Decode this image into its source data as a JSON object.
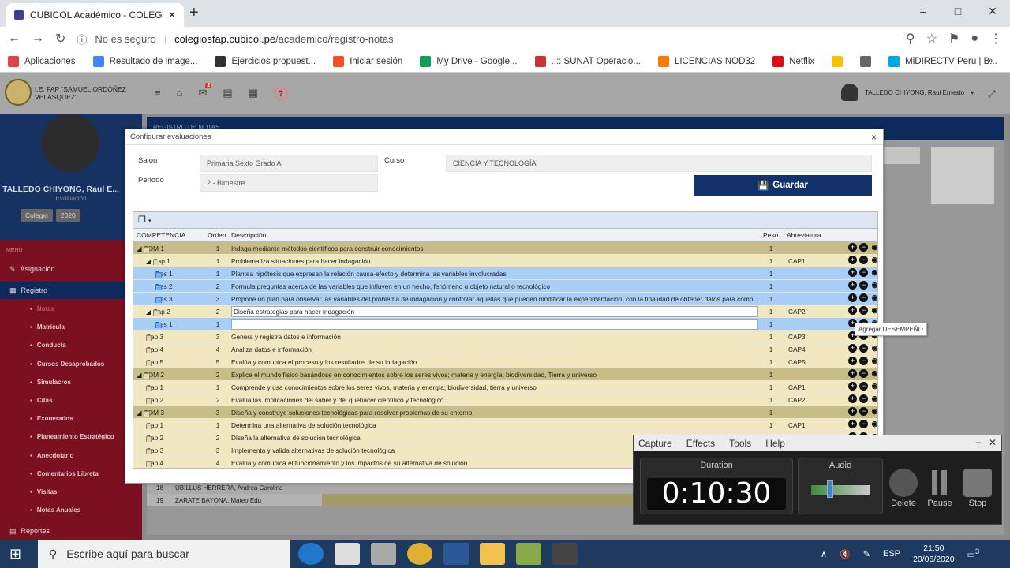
{
  "browser": {
    "tab_title": "CUBICOL Académico - COLEGIOS",
    "new_tab": "+",
    "window": {
      "minimize": "–",
      "maximize": "□",
      "close": "✕"
    },
    "security": "No es seguro",
    "url_host": "colegiosfap.cubicol.pe",
    "url_path": "/academico/registro-notas",
    "bookmarks": [
      {
        "label": "Aplicaciones",
        "color": "#d44"
      },
      {
        "label": "Resultado de image...",
        "color": "#4285f4"
      },
      {
        "label": "Ejercicios propuest...",
        "color": "#333"
      },
      {
        "label": "Iniciar sesión",
        "color": "#f25022"
      },
      {
        "label": "My Drive - Google...",
        "color": "#0f9d58"
      },
      {
        "label": "..:: SUNAT Operacio...",
        "color": "#c33"
      },
      {
        "label": "LICENCIAS NOD32",
        "color": "#f57c00"
      },
      {
        "label": "Netflix",
        "color": "#e50914"
      },
      {
        "label": "",
        "color": "#f4c20d"
      },
      {
        "label": "",
        "color": "#666"
      },
      {
        "label": "MiDIRECTV Peru | B...",
        "color": "#00a7e1"
      }
    ]
  },
  "app": {
    "school": "I.E. FAP \"SAMUEL ORDÓÑEZ VELÁSQUEZ\"",
    "mail_badge": "2",
    "user_name": "TALLEDO CHIYONG, Raul Ernesto",
    "side_name": "TALLEDO CHIYONG, Raul E...",
    "side_role": "Evaluación",
    "side_sel": [
      "Colegio",
      "2020"
    ],
    "menu_header": "MENÚ",
    "menu": [
      {
        "label": "Asignación",
        "top": 0
      },
      {
        "label": "Registro",
        "top": 0
      }
    ],
    "submenu": [
      "Notas",
      "Matrícula",
      "Conducta",
      "Cursos Desaprobados",
      "Simulacros",
      "Citas",
      "Exonerados",
      "Planeamiento Estratégico",
      "Anecdotario",
      "Comentarios Libreta",
      "Visitas",
      "Notas Anuales"
    ],
    "menu_reportes": "Reportes",
    "bg_panel_title": "REGISTRO DE NOTAS",
    "bg_rows": [
      {
        "n": "18",
        "name": "UBILLUS HERRERA, Andrea Carolina"
      },
      {
        "n": "19",
        "name": "ZARATE BAYONA, Mateo Edu"
      }
    ]
  },
  "dialog": {
    "title": "Configurar evaluaciones",
    "close": "×",
    "salon_label": "Salón",
    "salon_value": "Primaria Sexto Grado A",
    "curso_label": "Curso",
    "curso_value": "CIENCIA Y TECNOLOGÍA",
    "periodo_label": "Periodo",
    "periodo_value": "2 - Bimestre",
    "save_label": "Guardar",
    "headers": {
      "competencia": "COMPETENCIA",
      "orden": "Orden",
      "descripcion": "Descripción",
      "peso": "Peso",
      "abreviatura": "Abreviatura"
    },
    "tooltip": "Agregar DESEMPEÑO",
    "rows": [
      {
        "lvl": 0,
        "name": "COM 1",
        "ord": "1",
        "desc": "Indaga mediante métodos científicos para construir conocimientos",
        "peso": "1",
        "abr": "",
        "kind": "com",
        "tri": "▲"
      },
      {
        "lvl": 1,
        "name": "Cap 1",
        "ord": "1",
        "desc": "Problematiza situaciones para hacer indagación",
        "peso": "1",
        "abr": "CAP1",
        "kind": "cap",
        "tri": "▲"
      },
      {
        "lvl": 2,
        "name": "Des 1",
        "ord": "1",
        "desc": "Plantea hipótesis que expresan la relación causa-efecto y determina las variables involucradas",
        "peso": "1",
        "abr": "",
        "kind": "des",
        "tri": ""
      },
      {
        "lvl": 2,
        "name": "Des 2",
        "ord": "2",
        "desc": "Formula preguntas acerca de las variables que influyen en un hecho, fenómeno u objeto natural o tecnológico",
        "peso": "1",
        "abr": "",
        "kind": "des",
        "tri": ""
      },
      {
        "lvl": 2,
        "name": "Des 3",
        "ord": "3",
        "desc": "Propone un plan para observar las variables del problema de indagación y controlar aquellas que pueden modificar la experimentación, con la finalidad de obtener datos para comp...",
        "peso": "1",
        "abr": "",
        "kind": "des",
        "tri": ""
      },
      {
        "lvl": 1,
        "name": "Cap 2",
        "ord": "2",
        "desc": "Diseña estrategias para hacer indagación",
        "peso": "1",
        "abr": "CAP2",
        "kind": "cap-edit",
        "tri": "▲"
      },
      {
        "lvl": 2,
        "name": "Des 1",
        "ord": "1",
        "desc": "",
        "peso": "1",
        "abr": "",
        "kind": "des-sel",
        "tri": ""
      },
      {
        "lvl": 1,
        "name": "Cap 3",
        "ord": "3",
        "desc": "Genera y registra datos e información",
        "peso": "1",
        "abr": "CAP3",
        "kind": "cap",
        "tri": ""
      },
      {
        "lvl": 1,
        "name": "Cap 4",
        "ord": "4",
        "desc": "Analiza datos e información",
        "peso": "1",
        "abr": "CAP4",
        "kind": "cap",
        "tri": ""
      },
      {
        "lvl": 1,
        "name": "Cap 5",
        "ord": "5",
        "desc": "Evalúa y comunica el proceso y los resultados de su indagación",
        "peso": "1",
        "abr": "CAP5",
        "kind": "cap",
        "tri": ""
      },
      {
        "lvl": 0,
        "name": "COM 2",
        "ord": "2",
        "desc": "Explica el mundo físico basándose en conocimientos sobre los seres vivos; materia y energía; biodiversidad, Tierra y universo",
        "peso": "1",
        "abr": "",
        "kind": "com",
        "tri": "▲"
      },
      {
        "lvl": 1,
        "name": "Cap 1",
        "ord": "1",
        "desc": "Comprende y usa conocimientos sobre los seres vivos, materia y energía; biodiversidad, tierra y universo",
        "peso": "1",
        "abr": "CAP1",
        "kind": "cap",
        "tri": ""
      },
      {
        "lvl": 1,
        "name": "Cap 2",
        "ord": "2",
        "desc": "Evalúa las implicaciones del saber y del quehacer científico y tecnológico",
        "peso": "1",
        "abr": "CAP2",
        "kind": "cap",
        "tri": ""
      },
      {
        "lvl": 0,
        "name": "COM 3",
        "ord": "3",
        "desc": "Diseña y construye soluciones tecnológicas para resolver problemas de su entorno",
        "peso": "1",
        "abr": "",
        "kind": "com",
        "tri": "▲"
      },
      {
        "lvl": 1,
        "name": "Cap 1",
        "ord": "1",
        "desc": "Determina una alternativa de solución tecnológica",
        "peso": "1",
        "abr": "CAP1",
        "kind": "cap",
        "tri": ""
      },
      {
        "lvl": 1,
        "name": "Cap 2",
        "ord": "2",
        "desc": "Diseña la alternativa de solución tecnológica",
        "peso": "1",
        "abr": "CAP2",
        "kind": "cap",
        "tri": ""
      },
      {
        "lvl": 1,
        "name": "Cap 3",
        "ord": "3",
        "desc": "Implementa y valida alternativas de solución tecnológica",
        "peso": "",
        "abr": "",
        "kind": "cap",
        "tri": ""
      },
      {
        "lvl": 1,
        "name": "Cap 4",
        "ord": "4",
        "desc": "Evalúa y comunica el funcionamiento y los impactos de su alternativa de solución",
        "peso": "",
        "abr": "",
        "kind": "cap",
        "tri": ""
      }
    ]
  },
  "recorder": {
    "menu": [
      "Capture",
      "Effects",
      "Tools",
      "Help"
    ],
    "duration_label": "Duration",
    "time": "0:10:30",
    "audio_label": "Audio",
    "buttons": [
      "Delete",
      "Pause",
      "Stop"
    ],
    "audio_level": 0.55
  },
  "taskbar": {
    "search": "Escribe aquí para buscar",
    "lang": "ESP",
    "time": "21:50",
    "date": "20/06/2020",
    "notif": "3"
  }
}
